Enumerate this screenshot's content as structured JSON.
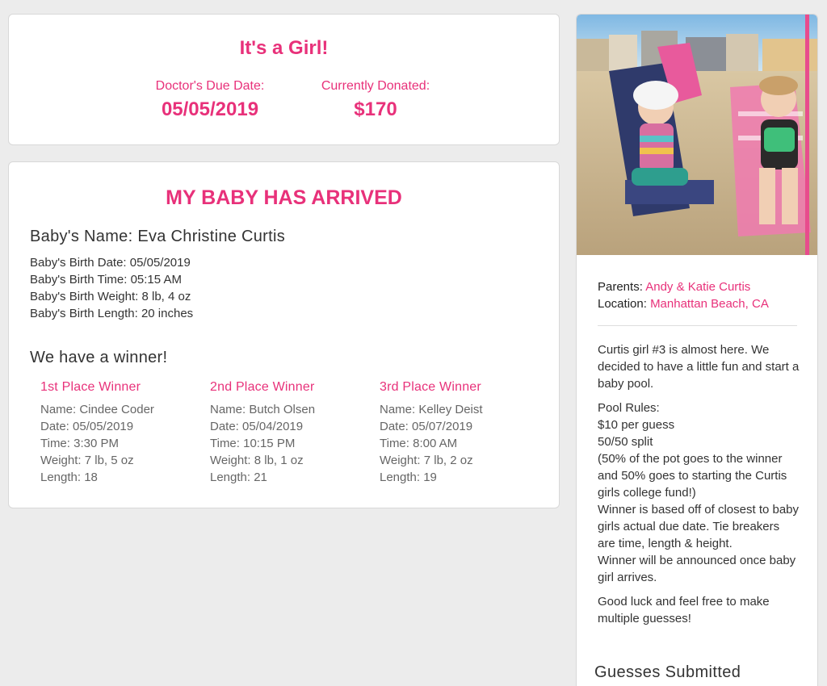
{
  "summary": {
    "gender_text": "It's a Girl!",
    "due_date_label": "Doctor's Due Date:",
    "due_date_value": "05/05/2019",
    "donated_label": "Currently Donated:",
    "donated_value": "$170"
  },
  "arrival": {
    "heading": "MY BABY HAS ARRIVED",
    "baby_name_label": "Baby's Name:",
    "baby_name": "Eva Christine Curtis",
    "birth_date": "Baby's Birth Date: 05/05/2019",
    "birth_time": "Baby's Birth Time: 05:15 AM",
    "birth_weight": "Baby's Birth Weight: 8 lb, 4 oz",
    "birth_length": "Baby's Birth Length: 20 inches",
    "winner_heading": "We have a winner!",
    "winners": [
      {
        "place": "1st Place Winner",
        "name": "Name: Cindee Coder",
        "date": "Date: 05/05/2019",
        "time": "Time: 3:30 PM",
        "weight": "Weight: 7 lb, 5 oz",
        "length": "Length: 18"
      },
      {
        "place": "2nd Place Winner",
        "name": "Name: Butch Olsen",
        "date": "Date: 05/04/2019",
        "time": "Time: 10:15 PM",
        "weight": "Weight: 8 lb, 1 oz",
        "length": "Length: 21"
      },
      {
        "place": "3rd Place Winner",
        "name": "Name: Kelley Deist",
        "date": "Date: 05/07/2019",
        "time": "Time: 8:00 AM",
        "weight": "Weight: 7 lb, 2 oz",
        "length": "Length: 19"
      }
    ]
  },
  "sidebar": {
    "parents_label": "Parents:",
    "parents_value": "Andy & Katie Curtis",
    "location_label": "Location:",
    "location_value": "Manhattan Beach, CA",
    "intro": "Curtis girl #3 is almost here. We decided to have a little fun and start a baby pool.",
    "rules_lines": [
      "Pool Rules:",
      "$10 per guess",
      "50/50 split",
      "(50% of the pot goes to the winner and 50% goes to starting the Curtis girls college fund!)",
      "Winner is based off of closest to baby girls actual due date. Tie breakers are time, length & height.",
      "Winner will be announced once baby girl arrives."
    ],
    "closing": "Good luck and feel free to make multiple guesses!",
    "guesses_heading": "Guesses Submitted"
  },
  "colors": {
    "accent": "#e8317a",
    "background": "#ececec",
    "card": "#ffffff"
  }
}
